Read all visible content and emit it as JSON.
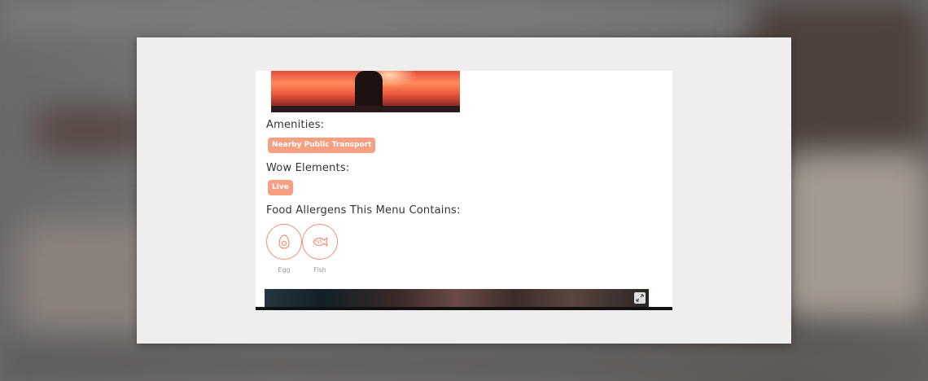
{
  "sections": {
    "amenities": {
      "title": "Amenities:",
      "chips": [
        "Nearby Public Transport"
      ]
    },
    "wow": {
      "title": "Wow Elements:",
      "chips": [
        "Live"
      ]
    },
    "allergens": {
      "title": "Food Allergens This Menu Contains:",
      "items": [
        {
          "label": "Egg",
          "icon": "egg-icon"
        },
        {
          "label": "Fish",
          "icon": "fish-icon"
        }
      ]
    }
  },
  "colors": {
    "accent": "#f79f83",
    "ring": "#f58e73",
    "panel": "#eeeeee"
  }
}
